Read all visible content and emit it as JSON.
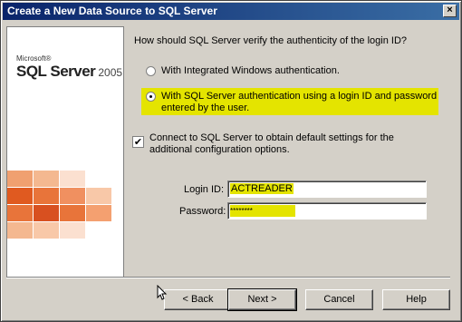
{
  "window": {
    "title": "Create a New Data Source to SQL Server",
    "close_label": "×"
  },
  "banner": {
    "brand": "Microsoft®",
    "product": "SQL Server",
    "version": "2005"
  },
  "auth": {
    "question": "How should SQL Server verify the authenticity of the login ID?",
    "option_windows": "With Integrated Windows authentication.",
    "option_sql_line1": "With SQL Server authentication using a login ID and password",
    "option_sql_line2": "entered by the user.",
    "selected": "sql"
  },
  "connect": {
    "checked": true,
    "label_line1": "Connect to SQL Server to obtain default settings for the",
    "label_line2": "additional configuration options."
  },
  "fields": {
    "login_label": "Login ID:",
    "login_value": "ACTREADER",
    "password_label": "Password:",
    "password_value": "********"
  },
  "buttons": {
    "back": "< Back",
    "next": "Next >",
    "cancel": "Cancel",
    "help": "Help"
  },
  "colors": {
    "title_start": "#0a246a",
    "title_end": "#3a6ea5",
    "highlight": "#e4e400",
    "tile_orange": "#e8743a"
  }
}
